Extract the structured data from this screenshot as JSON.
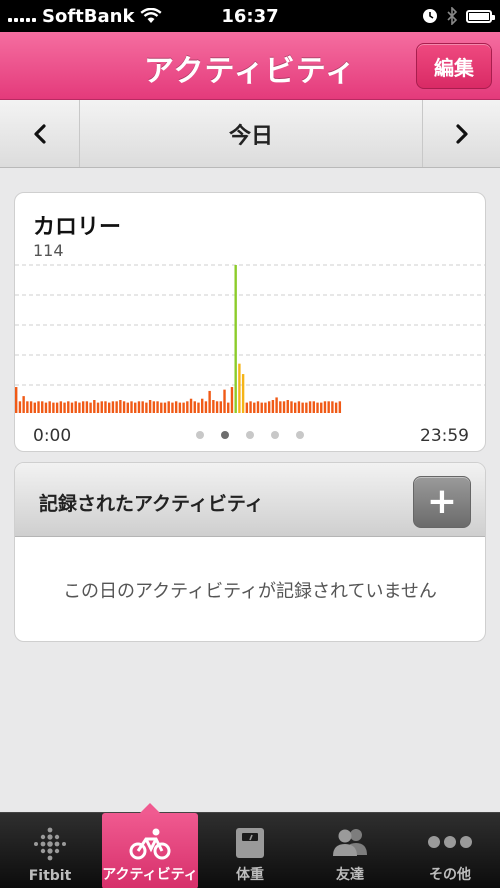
{
  "status_bar": {
    "carrier": "SoftBank",
    "time": "16:37"
  },
  "nav": {
    "title": "アクティビティ",
    "edit_label": "編集"
  },
  "date_nav": {
    "label": "今日"
  },
  "calories": {
    "title": "カロリー",
    "value": "114",
    "start_time": "0:00",
    "end_time": "23:59",
    "page_count": 5,
    "active_page": 1
  },
  "chart_data": {
    "type": "bar",
    "title": "カロリー",
    "x_range": [
      "0:00",
      "23:59"
    ],
    "ylim": [
      0,
      114
    ],
    "grid": true,
    "values": [
      20,
      9,
      13,
      9,
      9,
      8,
      9,
      9,
      8,
      9,
      8,
      8,
      9,
      8,
      9,
      8,
      9,
      8,
      9,
      9,
      8,
      10,
      8,
      9,
      9,
      8,
      9,
      9,
      10,
      9,
      8,
      9,
      8,
      9,
      9,
      8,
      10,
      9,
      9,
      8,
      8,
      9,
      8,
      9,
      8,
      8,
      9,
      11,
      9,
      8,
      11,
      9,
      17,
      10,
      9,
      9,
      18,
      8,
      20,
      114,
      38,
      30,
      8,
      9,
      8,
      9,
      8,
      8,
      9,
      10,
      12,
      9,
      9,
      10,
      9,
      8,
      9,
      8,
      8,
      9,
      9,
      8,
      8,
      9,
      9,
      9,
      8,
      9
    ],
    "colors": {
      "normal": "#f05a16",
      "peak": "#8ccc2a",
      "high": "#f5b418"
    }
  },
  "activities": {
    "title": "記録されたアクティビティ",
    "add_label": "+",
    "empty_message": "この日のアクティビティが記録されていません"
  },
  "tabs": [
    {
      "label": "Fitbit",
      "icon": "fitbit-icon",
      "active": false
    },
    {
      "label": "アクティビティ",
      "icon": "bicycle-icon",
      "active": true
    },
    {
      "label": "体重",
      "icon": "scale-icon",
      "active": false
    },
    {
      "label": "友達",
      "icon": "friends-icon",
      "active": false
    },
    {
      "label": "その他",
      "icon": "more-icon",
      "active": false
    }
  ],
  "colors": {
    "brand_pink": "#e43a7b"
  }
}
